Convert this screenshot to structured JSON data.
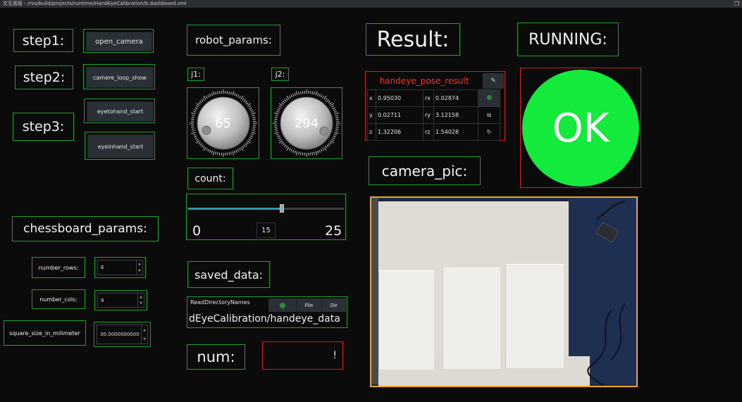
{
  "window": {
    "title": "交互面板 - /rvs/build/projects/runtime/HandEyeCalibration/b.dashboard.xml"
  },
  "steps": {
    "step1_label": "step1:",
    "step2_label": "step2:",
    "step3_label": "step3:",
    "open_camera": "open_camera",
    "camera_loop_show": "camere_loop_show",
    "eyetohand_start": "eyetohand_start",
    "eyeinhand_start": "eyeinhand_start"
  },
  "chessboard": {
    "title": "chessboard_params:",
    "number_rows_label": "number_rows:",
    "number_rows_value": "6",
    "number_cols_label": "number_cols:",
    "number_cols_value": "9",
    "square_size_label": "square_size_in_milimeter",
    "square_size_value": "30.0000000000"
  },
  "robot": {
    "title": "robot_params:",
    "j1_label": "j1:",
    "j1_value": 65,
    "j2_label": "j2:",
    "j2_value": 294,
    "count_label": "count:",
    "count_min": "0",
    "count_max": "25",
    "count_value": "15",
    "count_fraction": 0.6
  },
  "saved_data": {
    "title": "saved_data:",
    "widget_title": "ReadDirectoryNames",
    "file_button": "File",
    "dir_button": "Dir",
    "path": "dEyeCalibration/handeye_data"
  },
  "num": {
    "label": "num:",
    "value": "!"
  },
  "result": {
    "title": "Result:",
    "pose_title": "handeye_pose_result",
    "x_label": "x",
    "x_value": "0.95030",
    "y_label": "y",
    "y_value": "0.02711",
    "z_label": "z",
    "z_value": "1.32206",
    "rx_label": "rx",
    "rx_value": "0.02874",
    "ry_label": "ry",
    "ry_value": "3.12158",
    "rz_label": "rz",
    "rz_value": "1.54028"
  },
  "running": {
    "title": "RUNNING:",
    "status": "OK",
    "status_color": "#14ea3c"
  },
  "camera": {
    "title": "camera_pic:"
  },
  "colors": {
    "frame_green": "#1fa02b",
    "frame_red": "#d01f1f",
    "frame_orange": "#f0a51e",
    "pose_title_red": "#ff2a2a"
  }
}
